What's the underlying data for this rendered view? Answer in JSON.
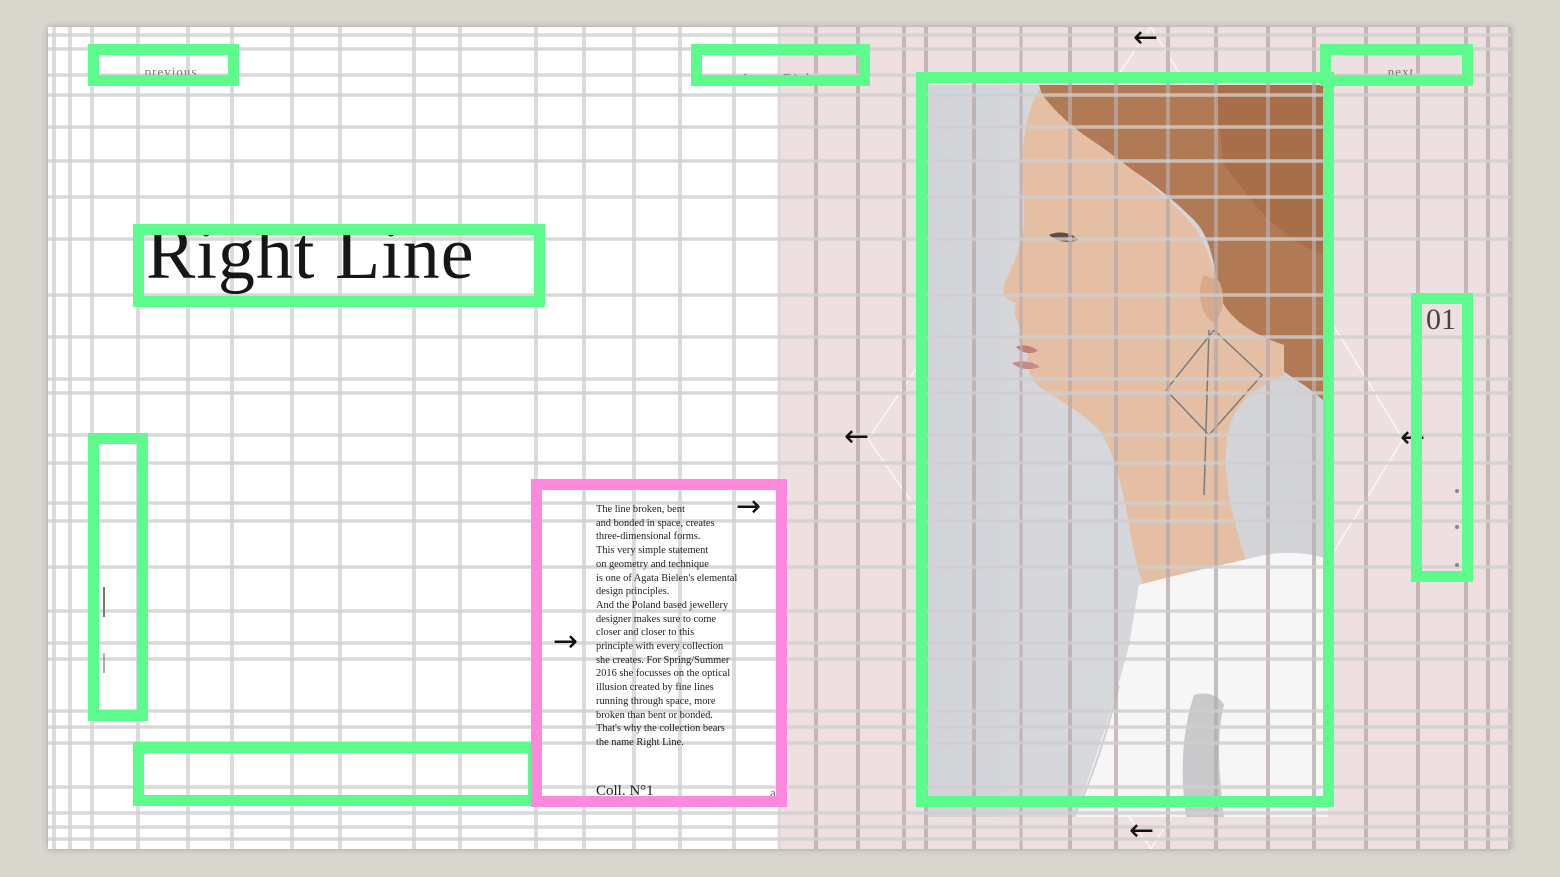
{
  "nav": {
    "previous_label": "previous",
    "next_label": "next",
    "brand_name": "Agata Bielen"
  },
  "main": {
    "title": "Right Line",
    "body_lines": [
      "The line broken, bent",
      "and bonded in space, creates",
      "three-dimensional forms.",
      "This very simple statement",
      "on geometry and technique",
      "is one of Agata Bielen's elemental",
      "design principles.",
      "And the Poland based jewellery",
      "designer makes sure to come",
      "closer and closer  to this",
      "principle with every collection",
      "she creates. For Spring/Summer",
      "2016 she focusses on the optical",
      "illusion created by fine lines",
      "running through space, more",
      "broken than bent or bonded.",
      "That's why the collection bears",
      "the name Right Line."
    ],
    "collection_label": "Coll. N°1",
    "view_all_label": "all"
  },
  "side": {
    "page_number": "01"
  },
  "icons": {
    "arrow_left": "←",
    "arrow_right": "→"
  },
  "colors": {
    "annotation_green": "#5cfb8c",
    "annotation_pink": "#fd89dc",
    "panel_pink": "#eedfe0",
    "background": "#d8d6cd"
  }
}
